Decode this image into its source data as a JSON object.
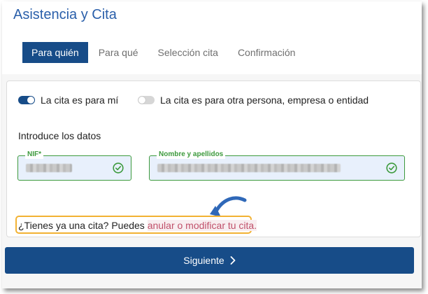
{
  "header": {
    "title": "Asistencia y Cita"
  },
  "tabs": [
    {
      "label": "Para quién",
      "active": true
    },
    {
      "label": "Para qué",
      "active": false
    },
    {
      "label": "Selección cita",
      "active": false
    },
    {
      "label": "Confirmación",
      "active": false
    }
  ],
  "form": {
    "toggle_self": {
      "label": "La cita es para mí",
      "on": true
    },
    "toggle_other": {
      "label": "La cita es para otra persona, empresa o entidad",
      "on": false
    },
    "section_label": "Introduce los datos",
    "nif": {
      "label": "NIF*",
      "value_state": "blurred",
      "valid": true
    },
    "nombre": {
      "label": "Nombre y apellidos",
      "value_state": "blurred",
      "valid": true
    },
    "existing": {
      "prefix": "¿Tienes ya una cita? Puedes ",
      "link": "anular o modificar tu cita."
    }
  },
  "actions": {
    "next_label": "Siguiente"
  },
  "colors": {
    "primary": "#174c88",
    "title": "#2a5faa",
    "valid": "#3d9a3d",
    "highlight": "#f2b233",
    "link": "#c0506a"
  },
  "icons": {
    "arrow": "curved-arrow-icon",
    "check": "check-circle-icon",
    "next": "chevron-right-icon"
  }
}
